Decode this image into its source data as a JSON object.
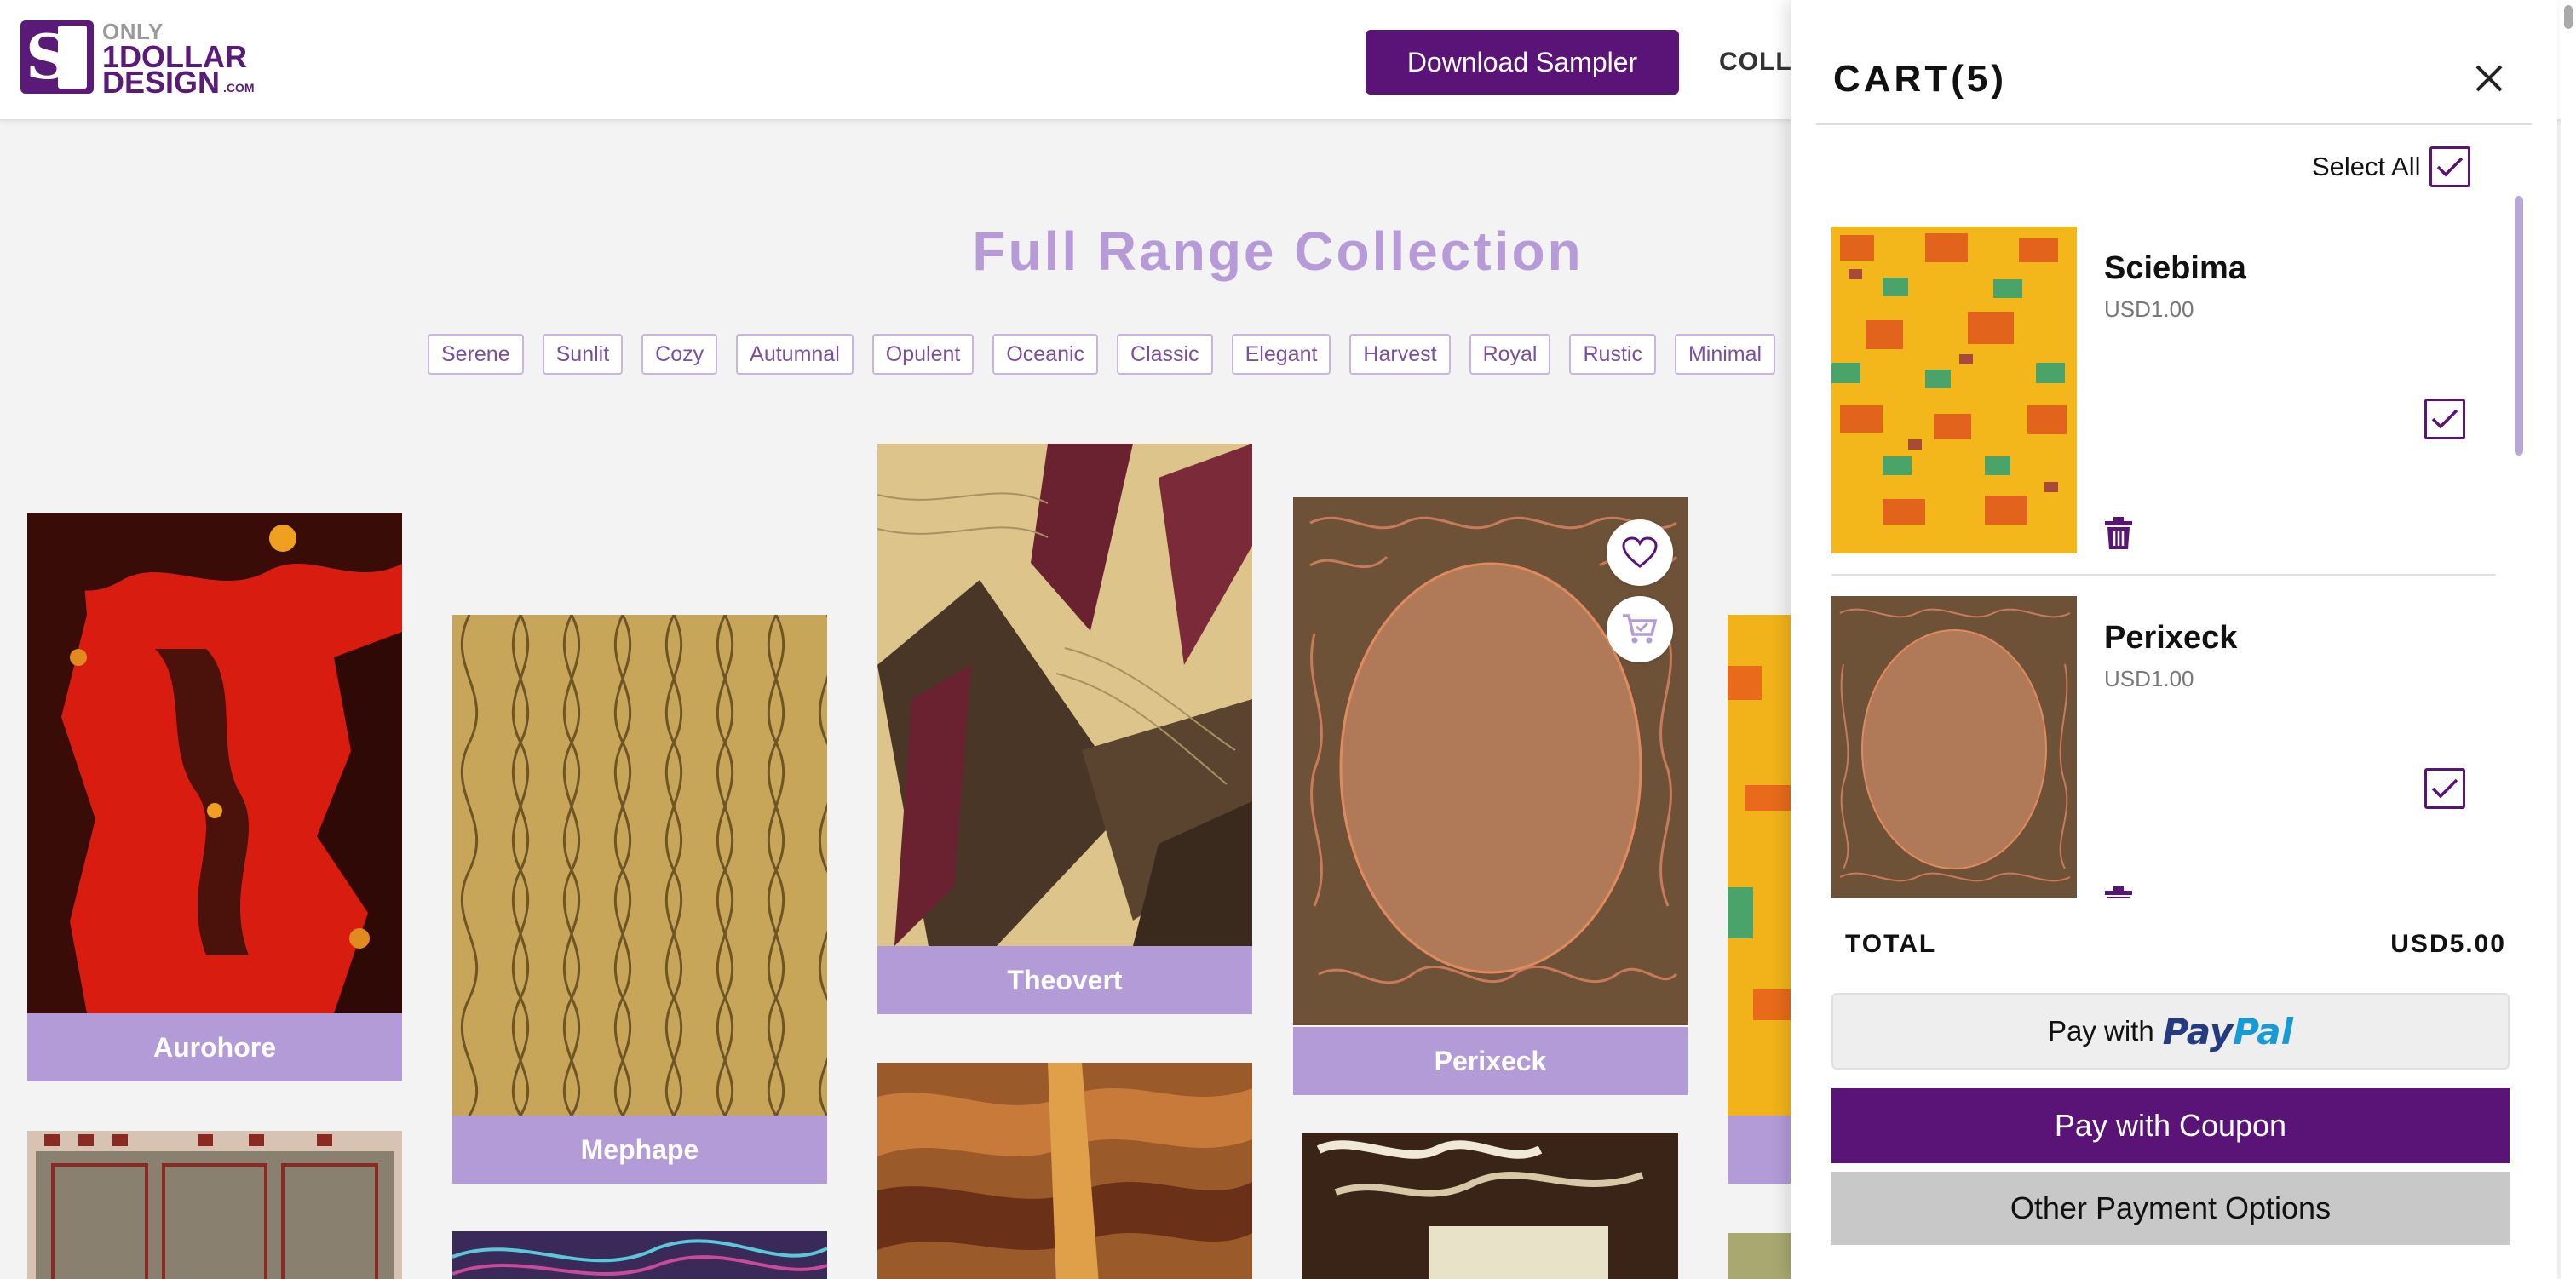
{
  "header": {
    "logo": {
      "line1": "ONLY",
      "line2": "1DOLLAR",
      "line3": "DESIGN",
      "suffix": ".COM"
    },
    "download_label": "Download Sampler",
    "nav_partial": "COLL"
  },
  "main": {
    "title": "Full Range Collection",
    "tags": [
      "Serene",
      "Sunlit",
      "Cozy",
      "Autumnal",
      "Opulent",
      "Oceanic",
      "Classic",
      "Elegant",
      "Harvest",
      "Royal",
      "Rustic",
      "Minimal"
    ],
    "products": [
      {
        "name": "Aurohore"
      },
      {
        "name": "Mephape"
      },
      {
        "name": "Theovert"
      },
      {
        "name": "Perixeck"
      }
    ]
  },
  "cart": {
    "title": "CART(5)",
    "select_all_label": "Select All",
    "items": [
      {
        "name": "Sciebima",
        "price": "USD1.00",
        "checked": true
      },
      {
        "name": "Perixeck",
        "price": "USD1.00",
        "checked": true
      }
    ],
    "total_label": "TOTAL",
    "total_value": "USD5.00",
    "pay_paypal_prefix": "Pay with",
    "pay_paypal_brand_1": "Pay",
    "pay_paypal_brand_2": "Pal",
    "pay_coupon_label": "Pay with Coupon",
    "pay_other_label": "Other Payment Options"
  },
  "colors": {
    "brand_purple": "#5a1478",
    "label_lavender": "#b39bd8",
    "title_lavender": "#b79ad8"
  }
}
